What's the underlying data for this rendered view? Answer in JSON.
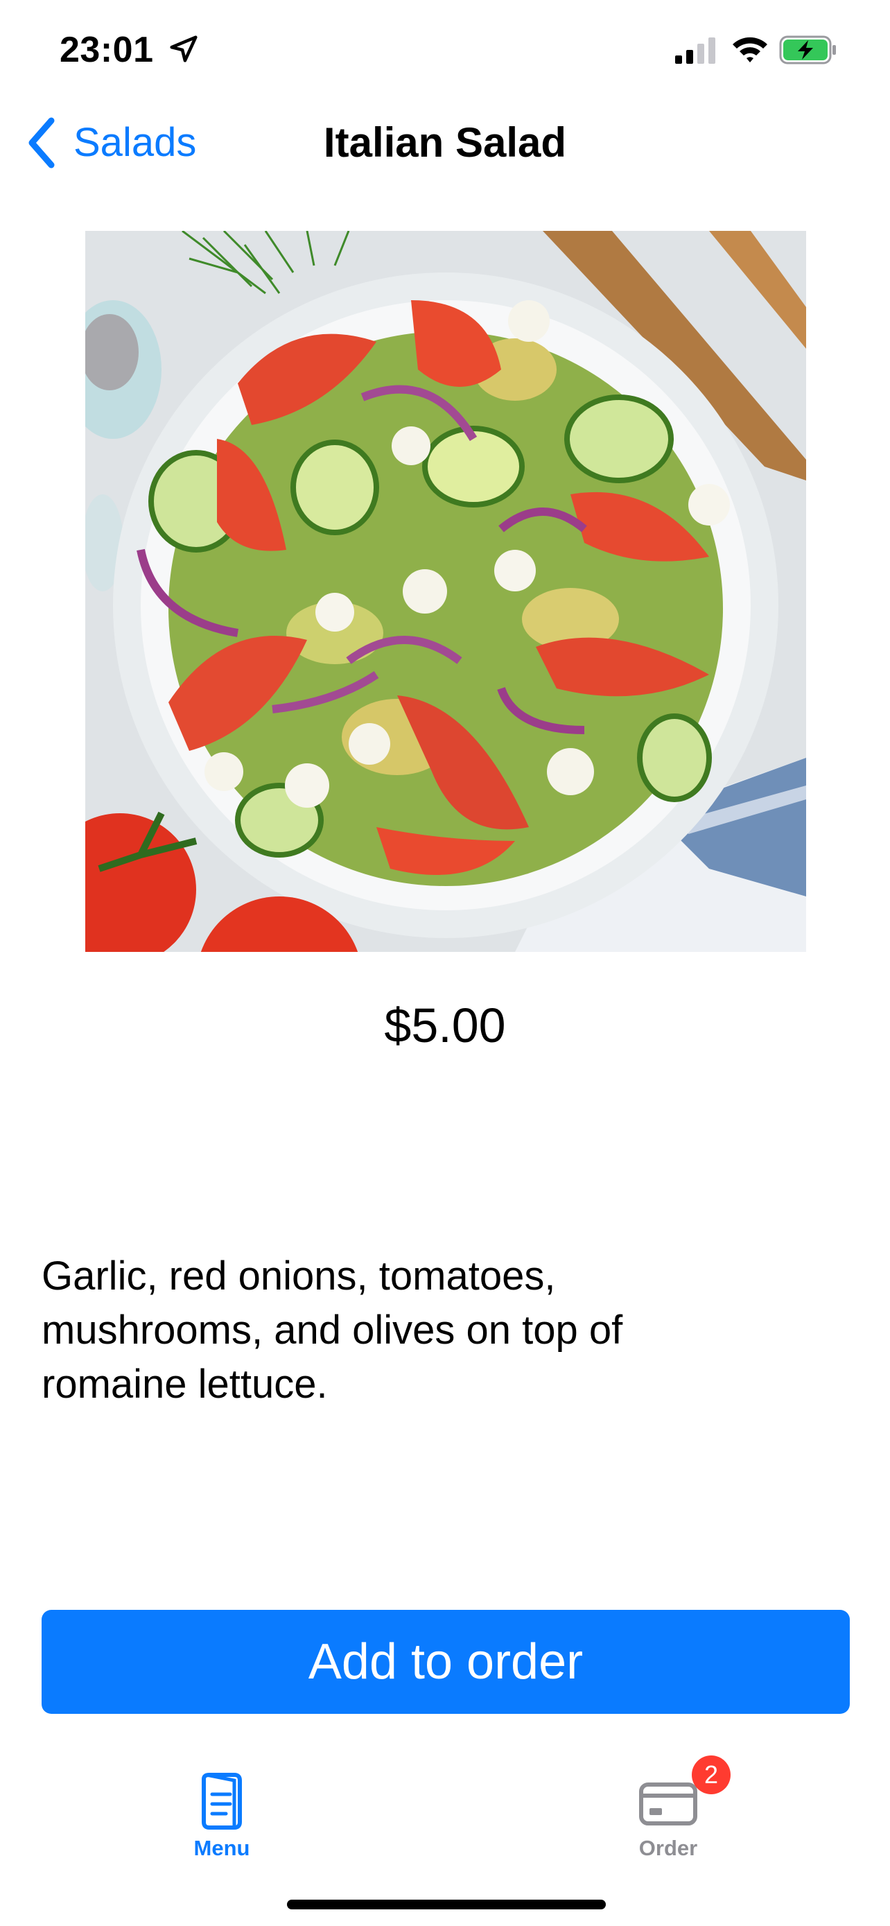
{
  "status_bar": {
    "time": "23:01",
    "icons": [
      "location-arrow-icon",
      "cellular-signal-icon",
      "wifi-icon",
      "battery-charging-icon"
    ]
  },
  "nav": {
    "back_label": "Salads",
    "title": "Italian Salad"
  },
  "product": {
    "image_alt": "Italian Salad",
    "price": "$5.00",
    "description": "Garlic, red onions, tomatoes, mushrooms, and olives on top of romaine lettuce."
  },
  "actions": {
    "add_to_order_label": "Add to order"
  },
  "tab_bar": {
    "tabs": [
      {
        "label": "Menu",
        "icon": "menu-document-icon",
        "active": true
      },
      {
        "label": "Order",
        "icon": "order-card-icon",
        "active": false,
        "badge": "2"
      }
    ]
  },
  "colors": {
    "accent": "#0a7bff",
    "badge": "#ff3b30",
    "inactive_tab": "#8e8e93",
    "battery_charging": "#34c759"
  }
}
